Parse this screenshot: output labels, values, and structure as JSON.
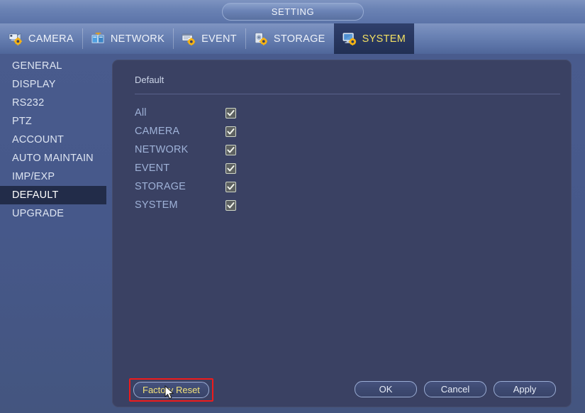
{
  "window": {
    "title": "SETTING"
  },
  "tabs": [
    {
      "label": "CAMERA",
      "icon": "camera-gear-icon",
      "active": false
    },
    {
      "label": "NETWORK",
      "icon": "network-icon",
      "active": false
    },
    {
      "label": "EVENT",
      "icon": "event-gear-icon",
      "active": false
    },
    {
      "label": "STORAGE",
      "icon": "storage-gear-icon",
      "active": false
    },
    {
      "label": "SYSTEM",
      "icon": "system-gear-icon",
      "active": true
    }
  ],
  "sidebar": {
    "items": [
      {
        "label": "GENERAL",
        "active": false
      },
      {
        "label": "DISPLAY",
        "active": false
      },
      {
        "label": "RS232",
        "active": false
      },
      {
        "label": "PTZ",
        "active": false
      },
      {
        "label": "ACCOUNT",
        "active": false
      },
      {
        "label": "AUTO MAINTAIN",
        "active": false
      },
      {
        "label": "IMP/EXP",
        "active": false
      },
      {
        "label": "DEFAULT",
        "active": true
      },
      {
        "label": "UPGRADE",
        "active": false
      }
    ]
  },
  "panel": {
    "title": "Default",
    "checkboxes": [
      {
        "label": "All",
        "checked": true
      },
      {
        "label": "CAMERA",
        "checked": true
      },
      {
        "label": "NETWORK",
        "checked": true
      },
      {
        "label": "EVENT",
        "checked": true
      },
      {
        "label": "STORAGE",
        "checked": true
      },
      {
        "label": "SYSTEM",
        "checked": true
      }
    ],
    "factory_reset_label": "Factory Reset",
    "buttons": [
      {
        "label": "OK"
      },
      {
        "label": "Cancel"
      },
      {
        "label": "Apply"
      }
    ]
  },
  "colors": {
    "background": "#46588a",
    "panel": "#3a4163",
    "active_tab_text": "#f2e063",
    "label_text": "#9fb2d8",
    "highlight_box": "#ef1b1b",
    "factory_reset_text": "#f3e27a"
  }
}
